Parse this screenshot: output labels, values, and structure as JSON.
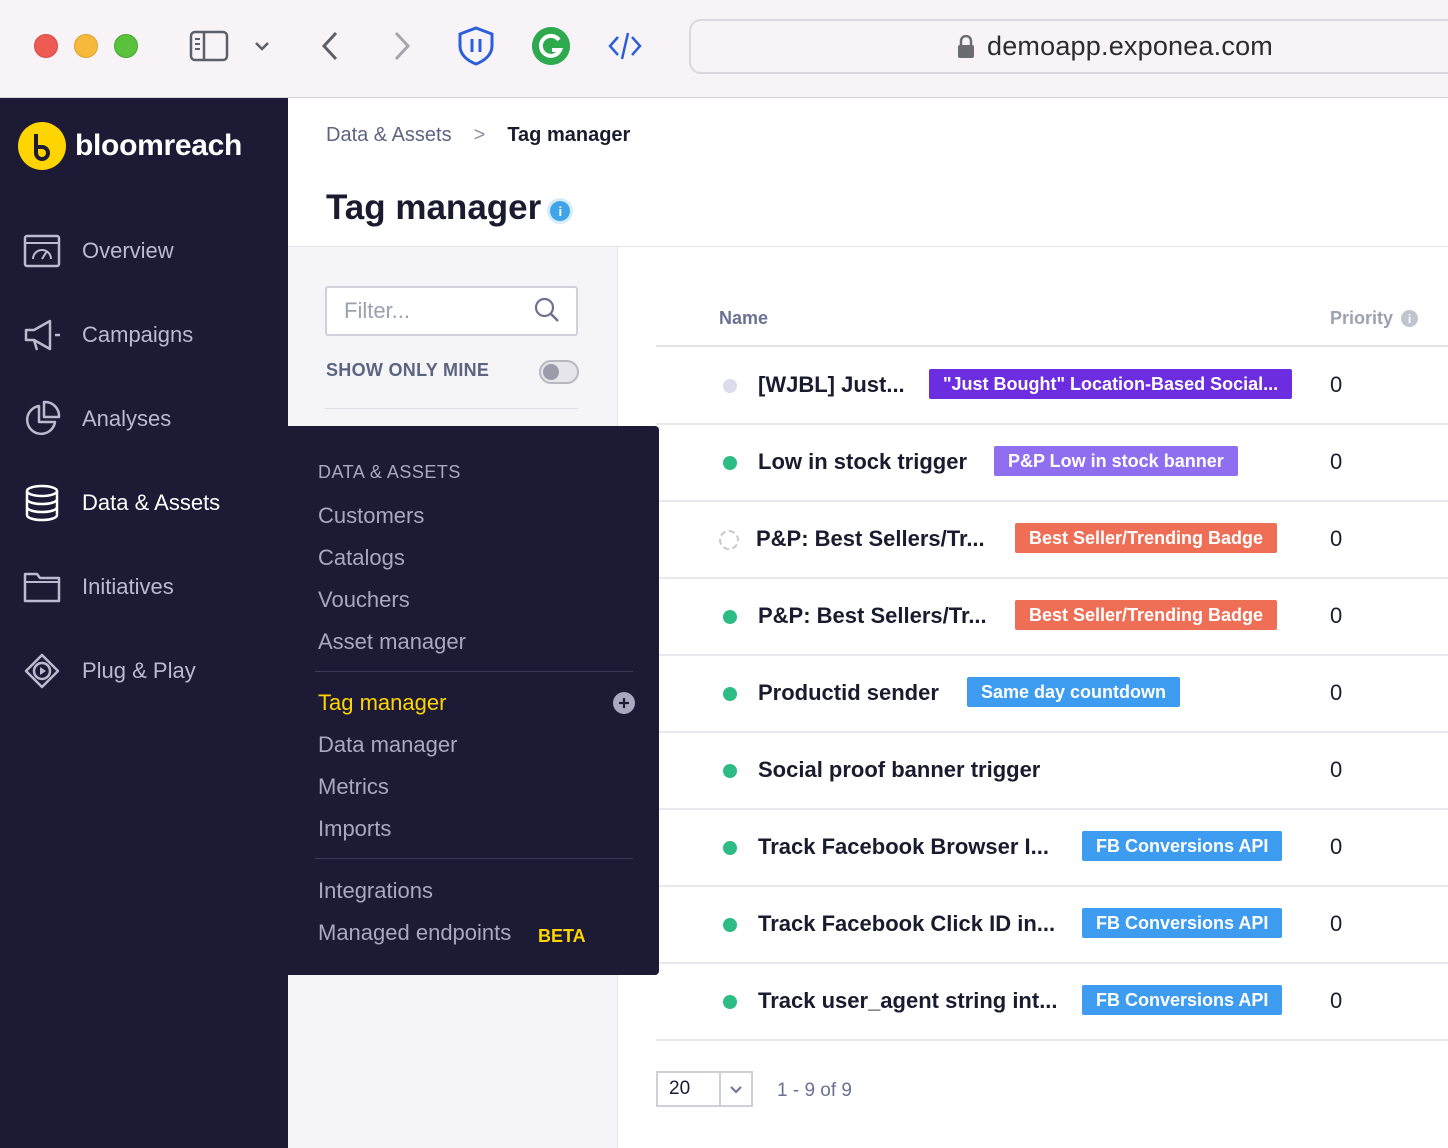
{
  "browser": {
    "url": "demoapp.exponea.com"
  },
  "brand": {
    "name": "bloomreach",
    "accent": "#ffd500"
  },
  "nav": {
    "items": [
      {
        "label": "Overview",
        "icon": "dashboard-icon"
      },
      {
        "label": "Campaigns",
        "icon": "megaphone-icon"
      },
      {
        "label": "Analyses",
        "icon": "pie-chart-icon"
      },
      {
        "label": "Data & Assets",
        "icon": "database-icon",
        "active": true
      },
      {
        "label": "Initiatives",
        "icon": "folder-icon"
      },
      {
        "label": "Plug & Play",
        "icon": "play-icon"
      }
    ]
  },
  "breadcrumb": {
    "parent": "Data & Assets",
    "separator": ">",
    "current": "Tag manager"
  },
  "page": {
    "title": "Tag manager",
    "info": "i"
  },
  "filter": {
    "placeholder": "Filter...",
    "show_only_mine": "SHOW ONLY MINE",
    "show_only_mine_enabled": false
  },
  "table": {
    "columns": {
      "name": "Name",
      "priority": "Priority",
      "priority_info": "i"
    },
    "rows": [
      {
        "status": "inactive",
        "name": "[WJBL] Just...",
        "tag": "\"Just Bought\" Location-Based Social...",
        "tag_color": "#6c2ce0",
        "priority": "0"
      },
      {
        "status": "active",
        "name": "Low in stock trigger",
        "tag": "P&P Low in stock banner",
        "tag_color": "#8f6ef0",
        "priority": "0"
      },
      {
        "status": "draft",
        "name": "P&P: Best Sellers/Tr...",
        "tag": "Best Seller/Trending Badge",
        "tag_color": "#ee6f55",
        "priority": "0"
      },
      {
        "status": "active",
        "name": "P&P: Best Sellers/Tr...",
        "tag": "Best Seller/Trending Badge",
        "tag_color": "#ee6f55",
        "priority": "0"
      },
      {
        "status": "active",
        "name": "Productid sender",
        "tag": "Same day countdown",
        "tag_color": "#3d9bf0",
        "priority": "0"
      },
      {
        "status": "active",
        "name": "Social proof banner trigger",
        "tag": "",
        "tag_color": "",
        "priority": "0"
      },
      {
        "status": "active",
        "name": "Track Facebook Browser I...",
        "tag": "FB Conversions API",
        "tag_color": "#3d9bf0",
        "priority": "0"
      },
      {
        "status": "active",
        "name": "Track Facebook Click ID in...",
        "tag": "FB Conversions API",
        "tag_color": "#3d9bf0",
        "priority": "0"
      },
      {
        "status": "active",
        "name": "Track user_agent string int...",
        "tag": "FB Conversions API",
        "tag_color": "#3d9bf0",
        "priority": "0"
      }
    ]
  },
  "pagination": {
    "page_size": "20",
    "range": "1 - 9 of 9"
  },
  "flyout": {
    "heading": "DATA & ASSETS",
    "group1": [
      "Customers",
      "Catalogs",
      "Vouchers",
      "Asset manager"
    ],
    "group2": [
      "Tag manager",
      "Data manager",
      "Metrics",
      "Imports"
    ],
    "active": "Tag manager",
    "group3": [
      "Integrations",
      "Managed endpoints"
    ],
    "beta": "BETA"
  },
  "colors": {
    "nav_bg": "#1c1a34",
    "status_active": "#2ebc86"
  }
}
